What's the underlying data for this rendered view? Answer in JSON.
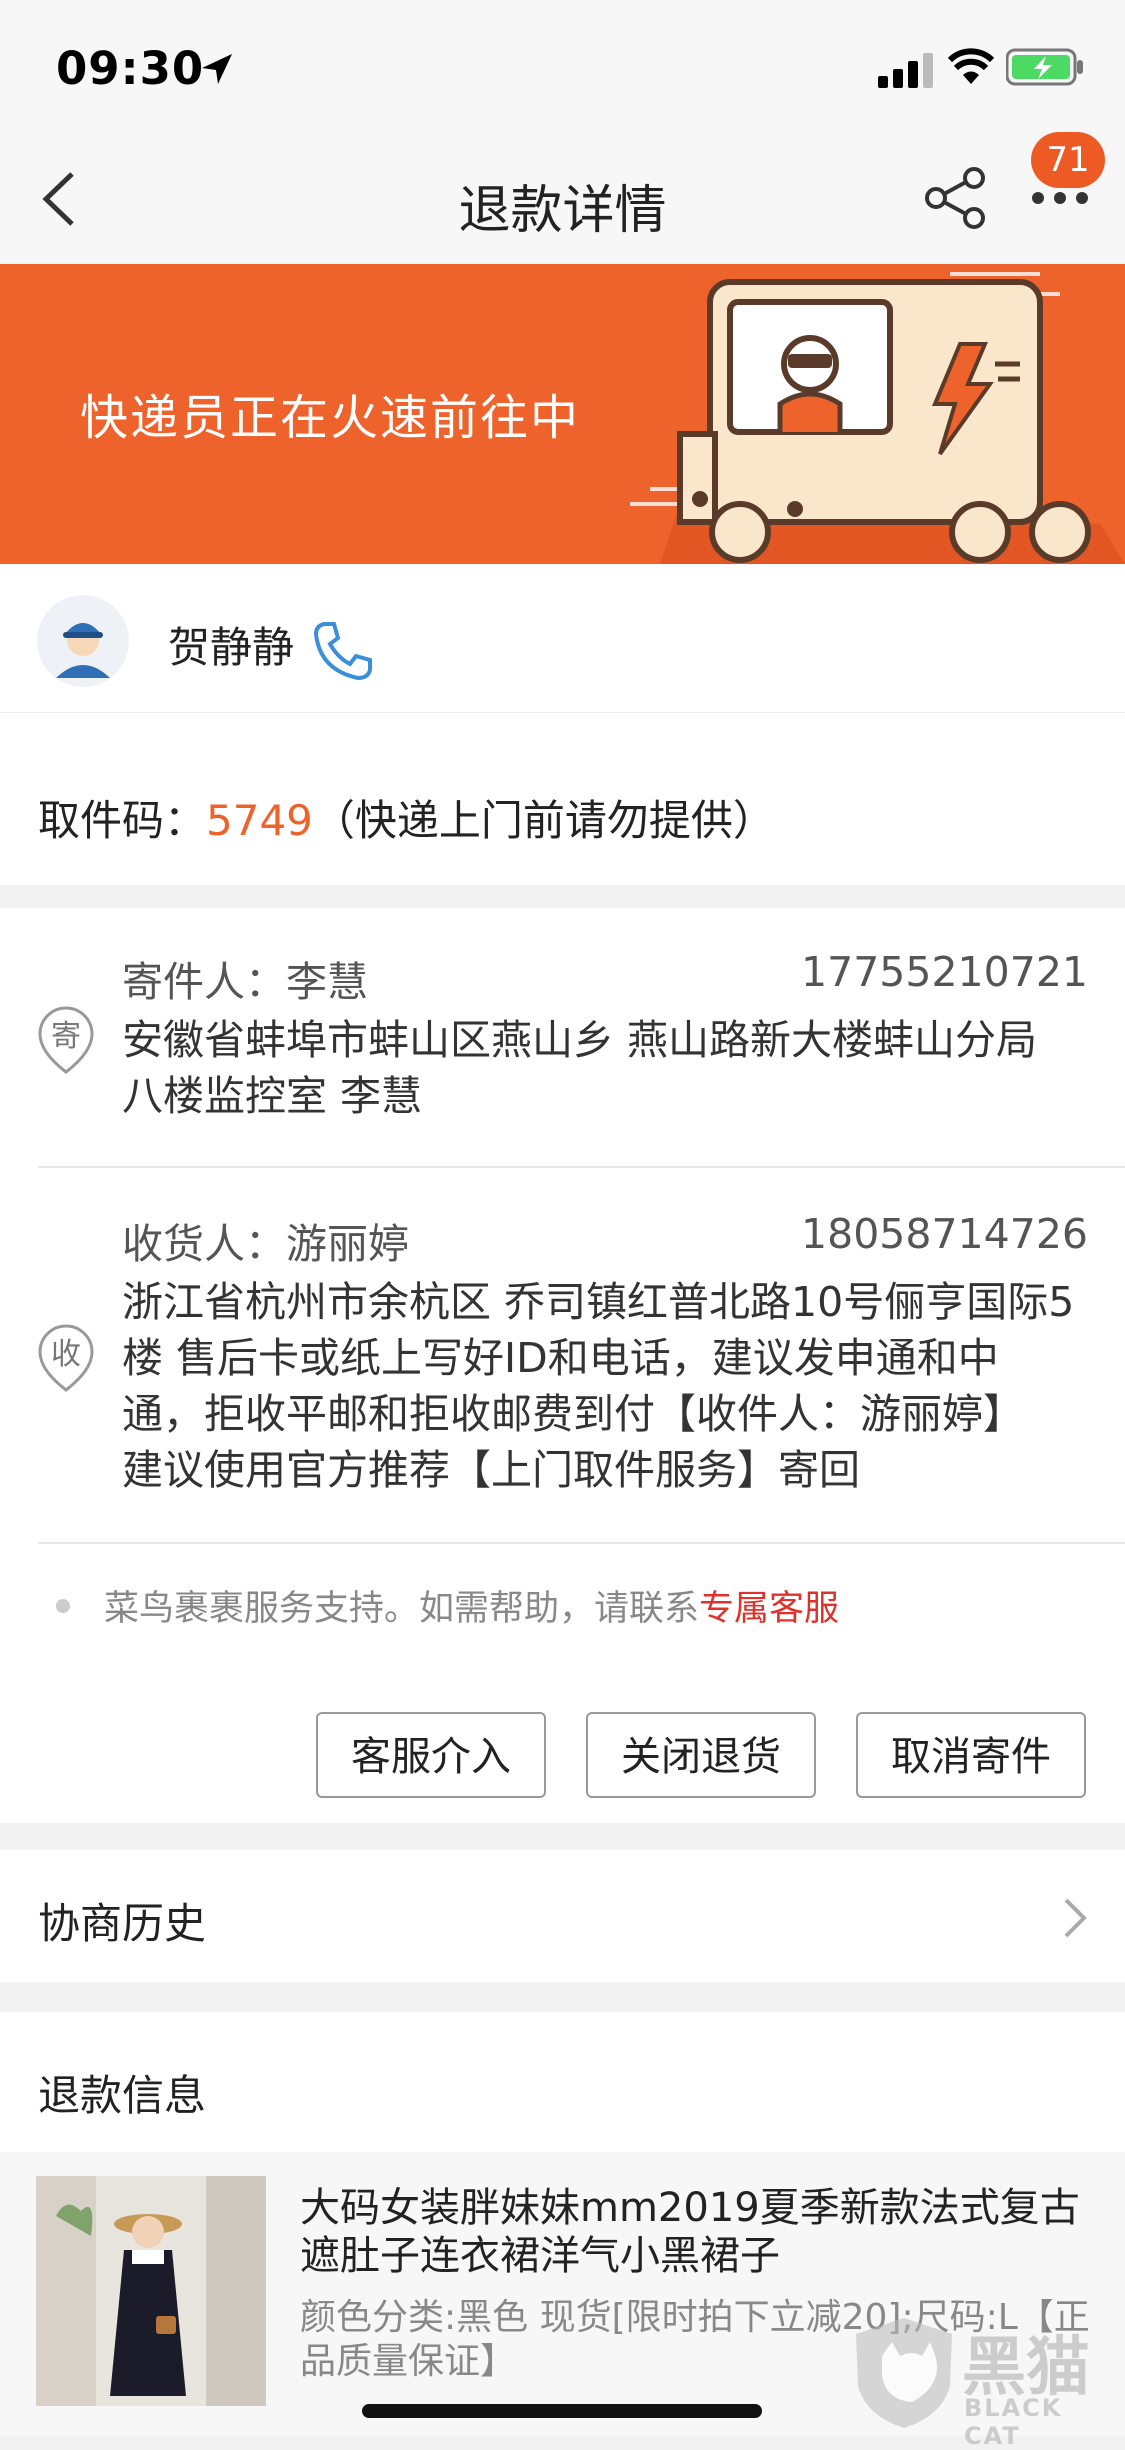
{
  "status_bar": {
    "time": "09:30"
  },
  "nav": {
    "title": "退款详情",
    "badge": "71"
  },
  "banner": {
    "text": "快递员正在火速前往中"
  },
  "courier": {
    "name": "贺静静"
  },
  "pickup": {
    "label": "取件码：",
    "code": "5749",
    "note": "（快递上门前请勿提供）"
  },
  "sender": {
    "badge": "寄",
    "label": "寄件人：",
    "name": "李慧",
    "phone": "17755210721",
    "address_line1": "安徽省蚌埠市蚌山区燕山乡 燕山路新大楼蚌山分局",
    "address_line2": "八楼监控室 李慧"
  },
  "receiver": {
    "badge": "收",
    "label": "收货人：",
    "name": "游丽婷",
    "phone": "18058714726",
    "address_line1": "浙江省杭州市余杭区 乔司镇红普北路10号俪亨国际5",
    "address_line2": "楼 售后卡或纸上写好ID和电话，建议发申通和中",
    "address_line3": "通，拒收平邮和拒收邮费到付【收件人：游丽婷】",
    "address_line4": "建议使用官方推荐【上门取件服务】寄回"
  },
  "support": {
    "text": "菜鸟裹裹服务支持。如需帮助，请联系",
    "link": "专属客服"
  },
  "actions": {
    "service": "客服介入",
    "close": "关闭退货",
    "cancel": "取消寄件"
  },
  "history": {
    "label": "协商历史"
  },
  "refund": {
    "title": "退款信息",
    "product_title": "大码女装胖妹妹mm2019夏季新款法式复古遮肚子连衣裙洋气小黑裙子",
    "product_spec": "颜色分类:黑色 现货[限时拍下立减20];尺码:L【正品质量保证】"
  },
  "watermark": {
    "text": "黑猫",
    "subtext": "BLACK CAT"
  },
  "colors": {
    "accent": "#ee622b",
    "link": "#e0312a",
    "badge": "#ee5a24",
    "phone_icon": "#3b8fd8"
  }
}
